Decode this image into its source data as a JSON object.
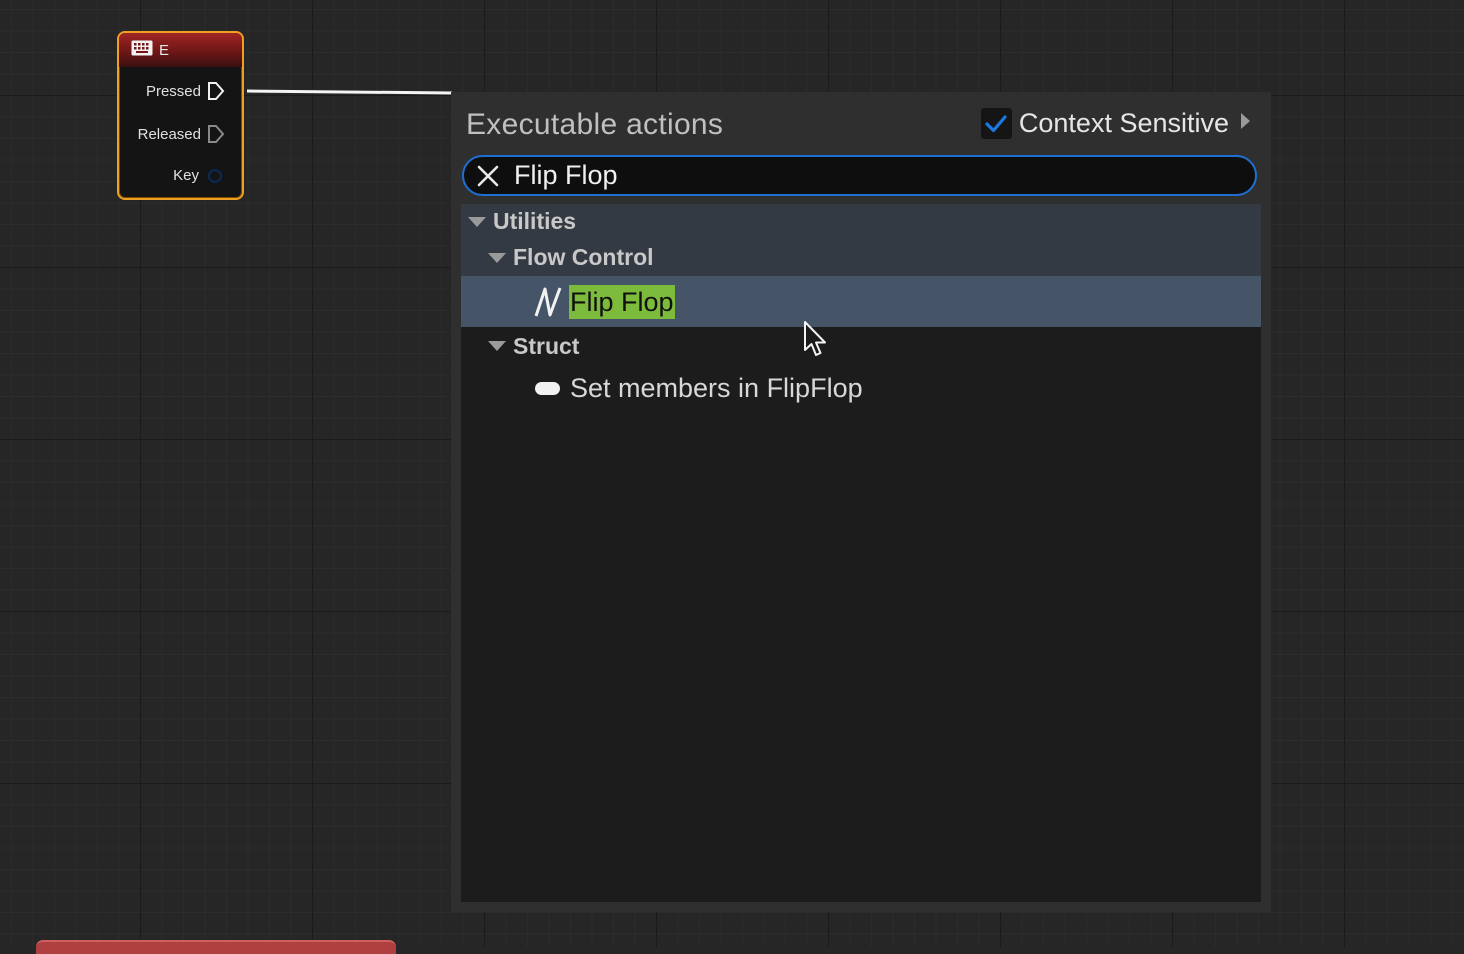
{
  "graph": {
    "input_node": {
      "title": "E",
      "icon": "keyboard-icon",
      "pins": {
        "pressed": "Pressed",
        "released": "Released",
        "key": "Key"
      }
    }
  },
  "action_menu": {
    "title": "Executable actions",
    "context_sensitive": {
      "label": "Context Sensitive",
      "checked": true
    },
    "search": {
      "value": "Flip Flop",
      "clear_icon": "close-icon"
    },
    "tree": {
      "utilities": "Utilities",
      "flow_control": "Flow Control",
      "flip_flop": "Flip Flop",
      "struct": "Struct",
      "set_members": "Set members in FlipFlop"
    }
  },
  "colors": {
    "selection_background": "#465468",
    "highlight": "#7dbb3c",
    "search_border": "#1f6fd1",
    "node_border": "#f0a020",
    "checkbox_check": "#1a7ae0"
  }
}
